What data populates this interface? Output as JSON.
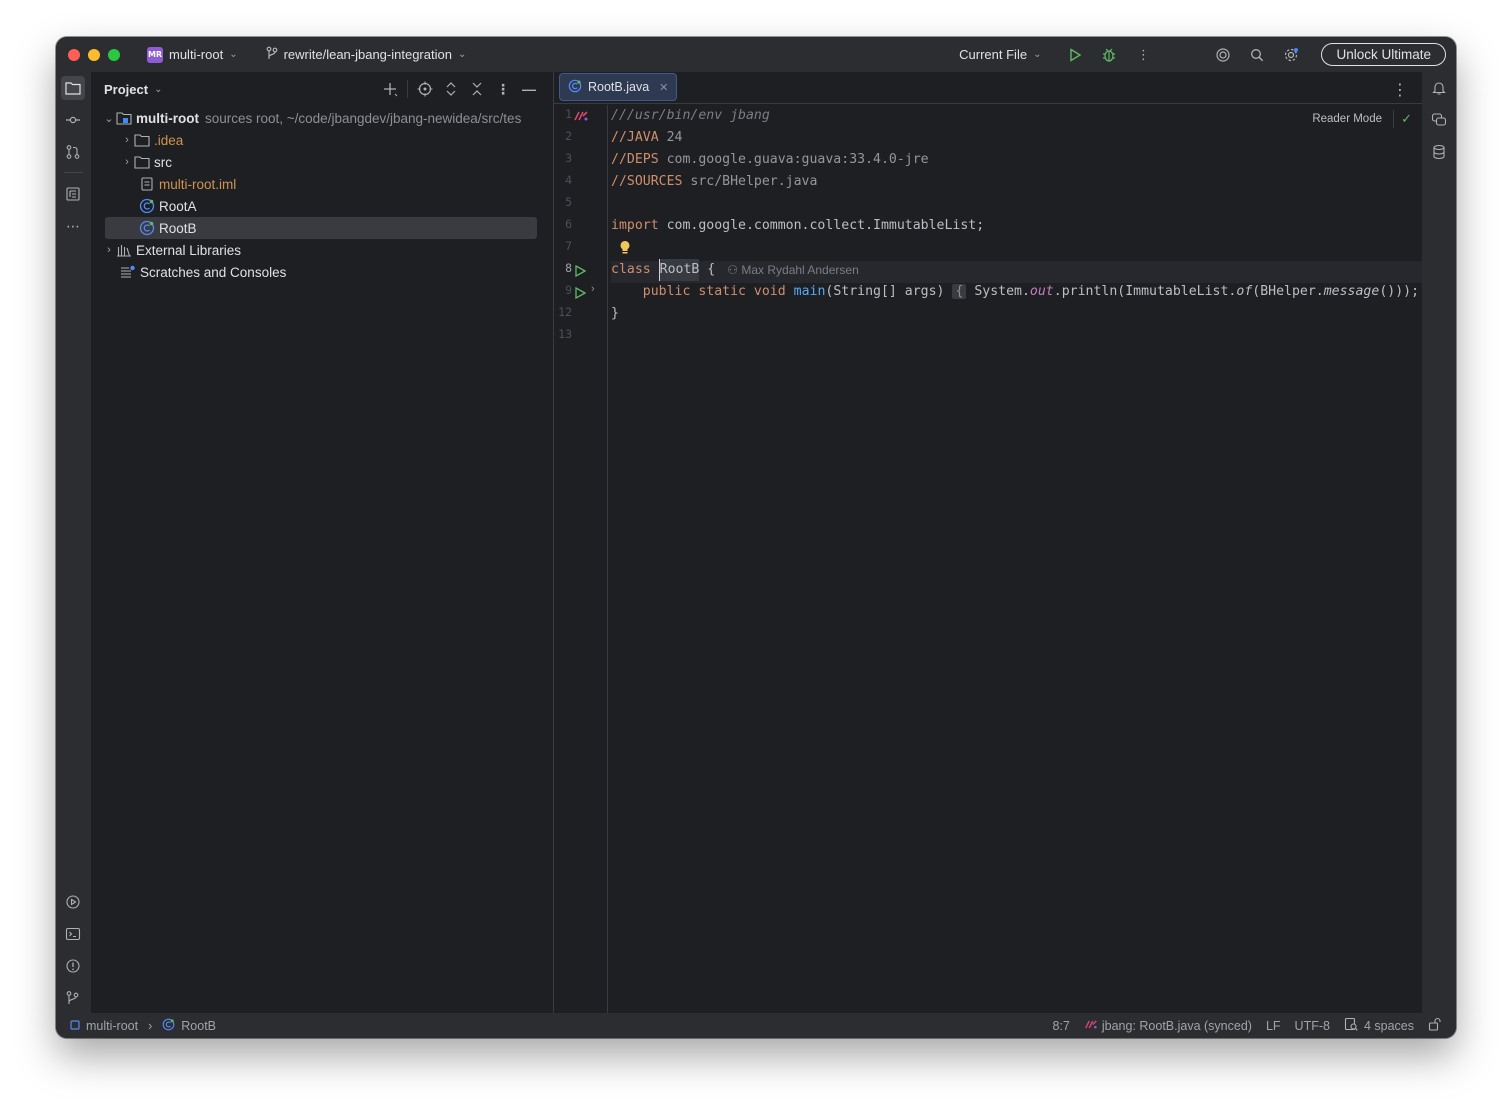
{
  "titlebar": {
    "project_badge": "MR",
    "project_name": "multi-root",
    "branch": "rewrite/lean-jbang-integration",
    "run_config": "Current File",
    "unlock": "Unlock Ultimate"
  },
  "project_panel": {
    "title": "Project",
    "tree": [
      {
        "name": "multi-root",
        "note": "sources root,  ~/code/jbangdev/jbang-newidea/src/tes"
      },
      {
        "name": ".idea"
      },
      {
        "name": "src"
      },
      {
        "name": "multi-root.iml"
      },
      {
        "name": "RootA"
      },
      {
        "name": "RootB"
      },
      {
        "name": "External Libraries"
      },
      {
        "name": "Scratches and Consoles"
      }
    ]
  },
  "editor": {
    "tab": "RootB.java",
    "reader_mode": "Reader Mode",
    "line_numbers": [
      "1",
      "2",
      "3",
      "4",
      "5",
      "6",
      "7",
      "8",
      "9",
      "12",
      "13"
    ],
    "code": {
      "l1": "///usr/bin/env jbang",
      "l2_tag": "//JAVA",
      "l2_val": " 24",
      "l3_tag": "//DEPS",
      "l3_val": " com.google.guava:guava:33.4.0-jre",
      "l4_tag": "//SOURCES",
      "l4_val": " src/BHelper.java",
      "l6_kw": "import",
      "l6_rest": " com.google.common.collect.ImmutableList;",
      "l8_kw": "class",
      "l8_name": "RootB",
      "l8_brace": " {",
      "author": "Max Rydahl Andersen",
      "l9_mods": "    public static void ",
      "l9_fn": "main",
      "l9_args": "(String[] args)",
      "l9_fold_open": "{",
      "l9_sys": "System.",
      "l9_out": "out",
      "l9_println": ".println(ImmutableList.",
      "l9_of": "of",
      "l9_bh": "(BHelper.",
      "l9_msg": "message",
      "l9_end": "()));",
      "l9_fold_close": "}",
      "l12": "}"
    }
  },
  "statusbar": {
    "project": "multi-root",
    "file": "RootB",
    "position": "8:7",
    "jbang": "jbang: RootB.java (synced)",
    "line_sep": "LF",
    "encoding": "UTF-8",
    "indent": "4 spaces"
  }
}
